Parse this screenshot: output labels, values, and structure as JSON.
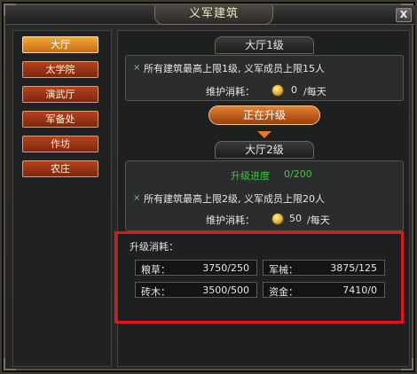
{
  "window": {
    "title": "义军建筑",
    "close_label": "X"
  },
  "nav": {
    "items": [
      {
        "label": "大厅",
        "active": true
      },
      {
        "label": "太学院",
        "active": false
      },
      {
        "label": "演武厅",
        "active": false
      },
      {
        "label": "军备处",
        "active": false
      },
      {
        "label": "作坊",
        "active": false
      },
      {
        "label": "农庄",
        "active": false
      }
    ]
  },
  "current": {
    "tab_label": "大厅1级",
    "effect_text": "所有建筑最高上限1级, 义军成员上限15人",
    "maint_label": "维护消耗：",
    "maint_value": "0",
    "maint_unit": "/每天"
  },
  "upgrade_button": "正在升级",
  "next": {
    "tab_label": "大厅2级",
    "progress_label": "升级进度",
    "progress_value": "0/200",
    "progress_fraction": 0,
    "effect_text": "所有建筑最高上限2级, 义军成员上限20人",
    "maint_label": "维护消耗：",
    "maint_value": "50",
    "maint_unit": "/每天"
  },
  "cost": {
    "title": "升级消耗：",
    "items": [
      {
        "label": "粮草：",
        "value": "3750/250"
      },
      {
        "label": "军械：",
        "value": "3875/125"
      },
      {
        "label": "砖木：",
        "value": "3500/500"
      },
      {
        "label": "资金：",
        "value": "7410/0"
      }
    ]
  },
  "colors": {
    "highlight_border": "#e2141c",
    "progress_text": "#3fc63f",
    "button_orange": "#e08234"
  }
}
